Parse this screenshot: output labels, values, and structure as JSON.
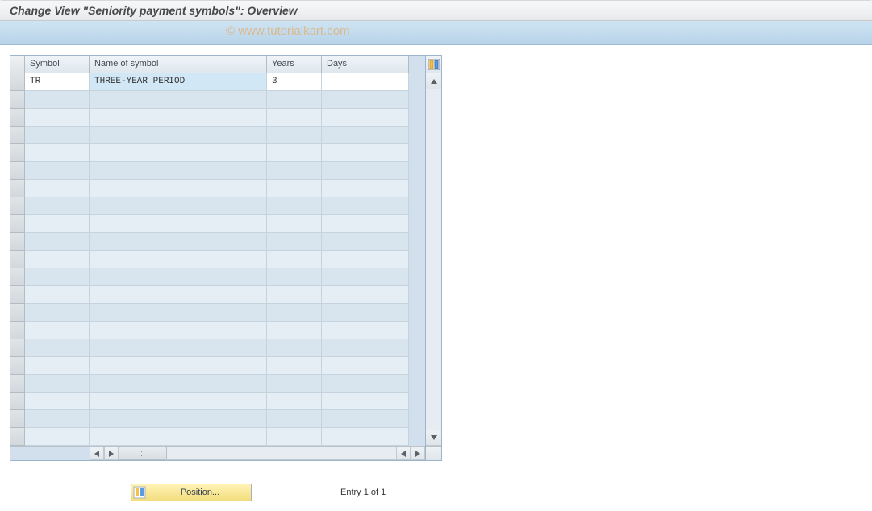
{
  "window": {
    "title": "Change View \"Seniority payment symbols\": Overview"
  },
  "watermark": "© www.tutorialkart.com",
  "table": {
    "columns": {
      "symbol": "Symbol",
      "name": "Name of symbol",
      "years": "Years",
      "days": "Days"
    },
    "rows": [
      {
        "symbol": "TR",
        "name": "THREE-YEAR PERIOD",
        "years": "3",
        "days": ""
      }
    ],
    "empty_row_count": 20
  },
  "footer": {
    "position_button": "Position...",
    "entry_label": "Entry 1 of 1"
  }
}
